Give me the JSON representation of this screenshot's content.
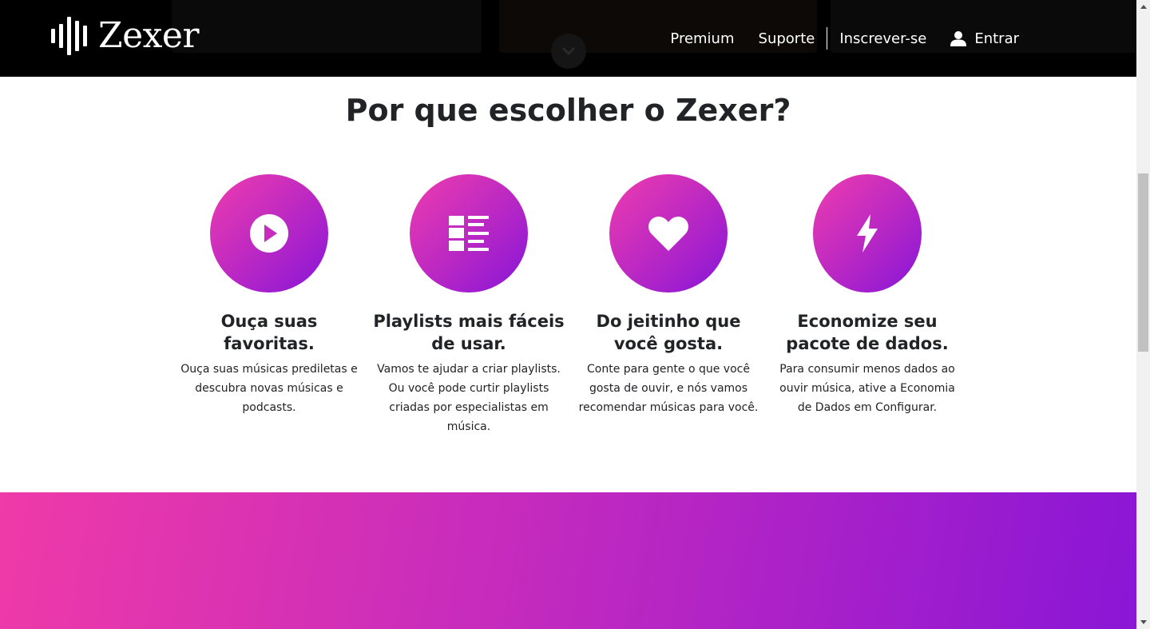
{
  "header": {
    "logo_text": "Zexer",
    "nav": {
      "premium": "Premium",
      "suporte": "Suporte",
      "inscrever": "Inscrever-se",
      "entrar": "Entrar"
    }
  },
  "features": {
    "title": "Por que escolher o Zexer?",
    "items": [
      {
        "icon": "play-circle-icon",
        "title": "Ouça suas favoritas.",
        "text": "Ouça suas músicas prediletas e descubra novas músicas e podcasts."
      },
      {
        "icon": "playlist-icon",
        "title": "Playlists mais fáceis de usar.",
        "text": "Vamos te ajudar a criar playlists. Ou você pode curtir playlists criadas por especialistas em música."
      },
      {
        "icon": "heart-icon",
        "title": "Do jeitinho que você gosta.",
        "text": "Conte para gente o que você gosta de ouvir, e nós vamos recomendar músicas para você."
      },
      {
        "icon": "lightning-icon",
        "title": "Economize seu pacote de dados.",
        "text": "Para consumir menos dados ao ouvir música, ative a Economia de Dados em Configurar."
      }
    ]
  },
  "colors": {
    "header_bg": "#000000",
    "gradient_start": "#ef3aa8",
    "gradient_end": "#8a16d6",
    "text": "#222326"
  }
}
